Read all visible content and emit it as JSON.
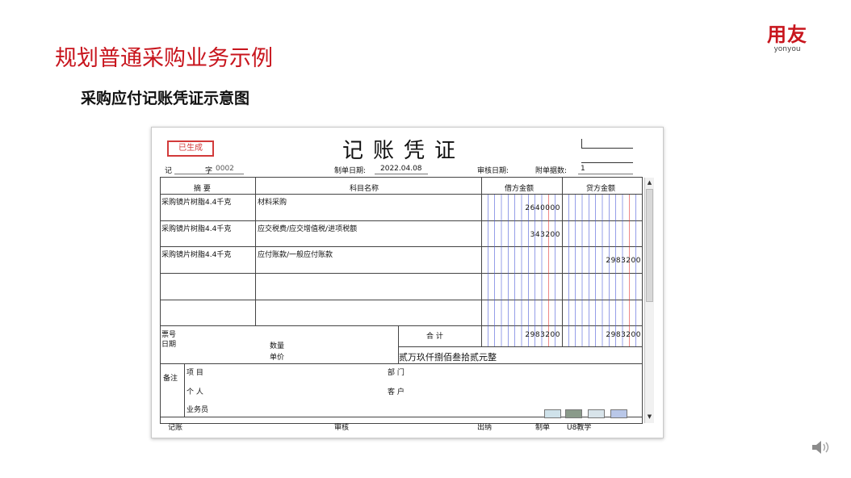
{
  "slide": {
    "title": "规划普通采购业务示例",
    "subtitle": "采购应付记账凭证示意图",
    "logo_main": "用友",
    "logo_sub": "yonyou"
  },
  "voucher": {
    "stamp": "已生成",
    "title": "记账凭证",
    "type_label": "记",
    "number_label": "字",
    "number": "0002",
    "date_label": "制单日期:",
    "date": "2022.04.08",
    "audit_date_label": "审核日期:",
    "attachments_label": "附单据数:",
    "attachments": "1",
    "headers": {
      "summary": "摘 要",
      "account": "科目名称",
      "debit": "借方金额",
      "credit": "贷方金额"
    },
    "rows": [
      {
        "summary": "采购镜片树脂4.4千克",
        "account": "材料采购",
        "debit": "2640000",
        "credit": ""
      },
      {
        "summary": "采购镜片树脂4.4千克",
        "account": "应交税费/应交增值税/进项税额",
        "debit": "343200",
        "credit": ""
      },
      {
        "summary": "采购镜片树脂4.4千克",
        "account": "应付账款/一般应付账款",
        "debit": "",
        "credit": "2983200"
      },
      {
        "summary": "",
        "account": "",
        "debit": "",
        "credit": ""
      },
      {
        "summary": "",
        "account": "",
        "debit": "",
        "credit": ""
      }
    ],
    "ticket_label": "票号",
    "ticket_date_label": "日期",
    "quantity_label": "数量",
    "unit_price_label": "单价",
    "total_label": "合 计",
    "total_debit": "2983200",
    "total_credit": "2983200",
    "total_words": "贰万玖仟捌佰叁拾贰元整",
    "remarks_label": "备注",
    "project_label": "项 目",
    "department_label": "部 门",
    "person_label": "个 人",
    "customer_label": "客 户",
    "salesperson_label": "业务员",
    "footer": {
      "bookkeeper_label": "记账",
      "reviewer_label": "审核",
      "cashier_label": "出纳",
      "preparer_label": "制单",
      "preparer": "U8教学"
    }
  },
  "icons": [
    "export-icon",
    "print-icon",
    "calc-icon",
    "collapse-icon",
    "speaker-icon",
    "scroll-up-icon",
    "scroll-down-icon"
  ],
  "colors": {
    "brand_red": "#c8151d",
    "grid_blue": "#4f5fd8",
    "grid_red": "#e33a3a"
  }
}
